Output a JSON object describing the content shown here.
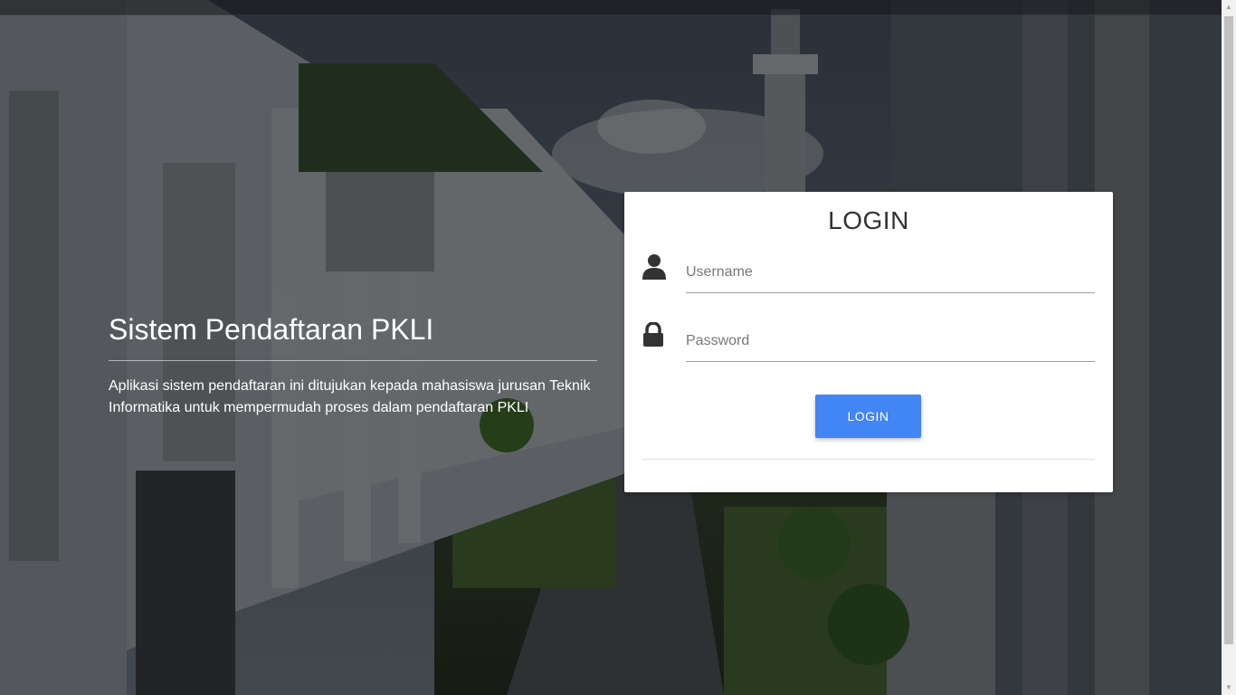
{
  "hero": {
    "title": "Sistem Pendaftaran PKLI",
    "description": "Aplikasi sistem pendaftaran ini ditujukan kepada mahasiswa jurusan Teknik Informatika untuk mempermudah proses dalam pendaftaran PKLI"
  },
  "login": {
    "title": "LOGIN",
    "username": {
      "placeholder": "Username",
      "value": "",
      "icon": "user-icon"
    },
    "password": {
      "placeholder": "Password",
      "value": "",
      "icon": "lock-icon"
    },
    "button_label": "LOGIN"
  },
  "colors": {
    "primary_button": "#4285f4",
    "card_background": "#ffffff",
    "overlay": "#000000"
  }
}
